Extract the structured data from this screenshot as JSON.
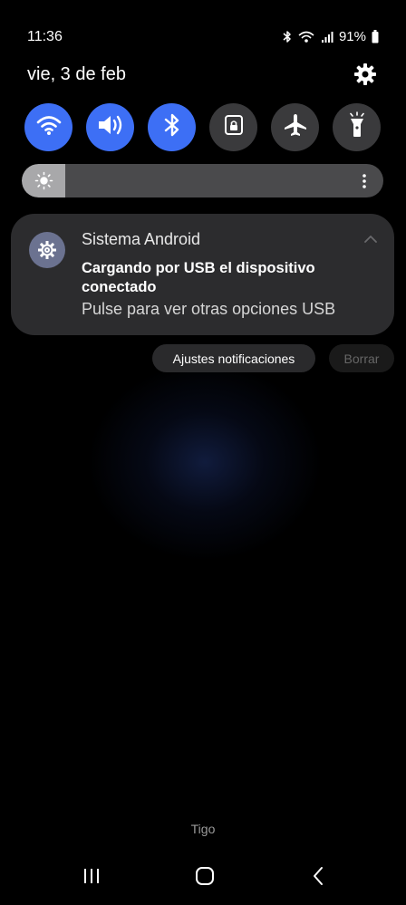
{
  "status_bar": {
    "time": "11:36",
    "battery_percent": "91%",
    "icons": [
      "bluetooth-icon",
      "wifi-icon",
      "signal-icon",
      "battery-icon"
    ]
  },
  "header": {
    "date": "vie, 3 de feb",
    "settings_icon": "gear-icon"
  },
  "quick_toggles": [
    {
      "icon": "wifi-icon",
      "state": "on"
    },
    {
      "icon": "sound-icon",
      "state": "on"
    },
    {
      "icon": "bluetooth-icon",
      "state": "on"
    },
    {
      "icon": "rotation-lock-icon",
      "state": "off"
    },
    {
      "icon": "airplane-icon",
      "state": "off"
    },
    {
      "icon": "flashlight-icon",
      "state": "off"
    }
  ],
  "brightness": {
    "level": 0.12,
    "icon": "sun-icon",
    "more_icon": "more-vertical-icon"
  },
  "notification": {
    "app_icon": "gear-icon",
    "app_name": "Sistema Android",
    "title": "Cargando por USB el dispositivo conectado",
    "text": "Pulse para ver otras opciones USB",
    "expand_icon": "chevron-up-icon"
  },
  "actions": {
    "settings_label": "Ajustes notificaciones",
    "clear_label": "Borrar"
  },
  "carrier": "Tigo",
  "nav_bar": {
    "icons": [
      "recents-icon",
      "home-icon",
      "back-icon"
    ]
  },
  "colors": {
    "accent": "#3d6ff5",
    "toggle_off": "#3a3a3c",
    "card": "#2c2c2e",
    "background": "#000000"
  }
}
